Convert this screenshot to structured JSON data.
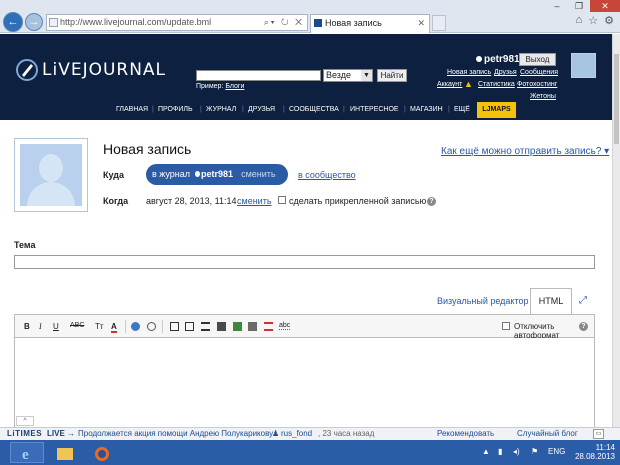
{
  "browser": {
    "url": "http://www.livejournal.com/update.bml",
    "tab_title": "Новая запись"
  },
  "header": {
    "logo_text": "LiVEJOURNAL",
    "search_scope": "Везде",
    "search_button": "Найти",
    "example_label": "Пример:",
    "example_link": "Блоги",
    "username": "petr981",
    "logout_label": "Выход",
    "links": {
      "new_post": "Новая запись",
      "friends": "Друзья",
      "messages": "Сообщения",
      "account": "Аккаунт",
      "stats": "Статистика",
      "photohosting": "Фотохостинг",
      "tokens": "Жетоны"
    },
    "nav": [
      "ГЛАВНАЯ",
      "ПРОФИЛЬ",
      "ЖУРНАЛ",
      "ДРУЗЬЯ",
      "СООБЩЕСТВА",
      "ИНТЕРЕСНОЕ",
      "МАГАЗИН",
      "ЕЩЁ"
    ],
    "ljmaps": "LJMAPS"
  },
  "post": {
    "title": "Новая запись",
    "other_ways": "Как ещё можно отправить запись?",
    "where_label": "Куда",
    "to_journal": "в журнал",
    "journal_user": "petr981",
    "change": "сменить",
    "to_community": "в сообщество",
    "when_label": "Когда",
    "date": "август 28, 2013, 11:14",
    "date_change": "сменить",
    "sticky_label": "сделать прикрепленной записью",
    "subject_label": "Тема",
    "visual_tab": "Визуальный редактор",
    "html_tab": "HTML",
    "autoformat_label": "Отключить автоформат"
  },
  "toolbar": {
    "bold": "B",
    "italic": "I",
    "underline": "U",
    "strike": "ABC",
    "size": "Tт",
    "color": "A",
    "spell": "abc"
  },
  "times": {
    "logo": "LiTIMES",
    "live": "LIVE →",
    "message": "Продолжается акция помощи Андрею Полукарикову",
    "user": "rus_fond",
    "ago": ", 23 часа назад",
    "recommended": "Рекомендовать",
    "random": "Случайный блог"
  },
  "taskbar": {
    "lang": "ENG",
    "time": "11:14",
    "date": "28.08.2013"
  }
}
